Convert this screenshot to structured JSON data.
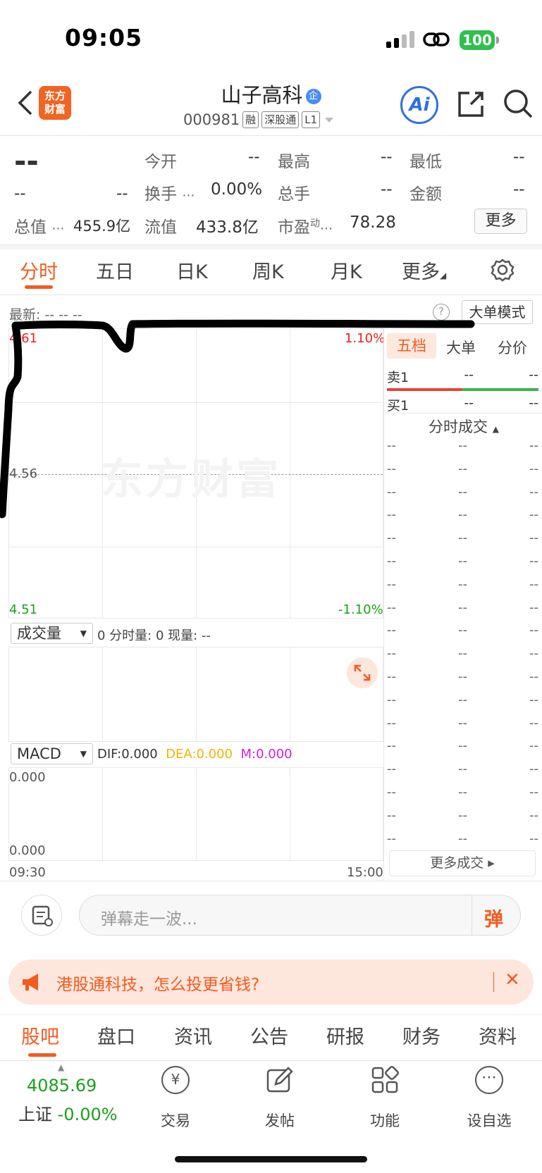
{
  "status_bar": {
    "time": "09:05",
    "battery": "100"
  },
  "header": {
    "title": "山子高科",
    "title_badge": "企",
    "code": "000981",
    "tags": [
      "融",
      "深股通",
      "L1"
    ],
    "logo_line1": "东方",
    "logo_line2": "财富",
    "ai_label": "Ai"
  },
  "quote": {
    "price": "--",
    "change": "--",
    "change_pct": "--",
    "open_label": "今开",
    "open": "--",
    "high_label": "最高",
    "high": "--",
    "low_label": "最低",
    "low": "--",
    "turnover_label": "换手",
    "turnover": "0.00%",
    "volume_label": "总手",
    "volume": "--",
    "amount_label": "金额",
    "amount": "--",
    "mcap_label": "总值",
    "mcap": "455.9亿",
    "float_label": "流值",
    "float": "433.8亿",
    "pe_label": "市盈",
    "pe_sup": "动",
    "pe": "78.28",
    "more_button": "更多"
  },
  "chart_tabs": [
    "分时",
    "五日",
    "日K",
    "周K",
    "月K",
    "更多"
  ],
  "chart_info": {
    "latest_label": "最新:",
    "latest_values": "--  --  --",
    "mode_button": "大单模式"
  },
  "intraday_chart": {
    "y_top": "4.61",
    "y_mid": "4.56",
    "y_bottom": "4.51",
    "pct_top": "1.10%",
    "pct_bottom": "-1.10%",
    "watermark": "东方财富",
    "time_start": "09:30",
    "time_end": "15:00"
  },
  "volume_panel": {
    "selector": "成交量",
    "info": "0 分时量: 0 现量: --"
  },
  "macd_panel": {
    "selector": "MACD",
    "dif": "DIF:0.000",
    "dea": "DEA:0.000",
    "m": "M:0.000",
    "y_top": "0.000",
    "y_bottom": "0.000"
  },
  "side_panel": {
    "tabs": [
      "五档",
      "大单",
      "分价"
    ],
    "sell1_label": "卖1",
    "sell1_price": "--",
    "sell1_vol": "--",
    "buy1_label": "买1",
    "buy1_price": "--",
    "buy1_vol": "--",
    "trades_title": "分时成交",
    "trade_placeholder": "--",
    "more_trades": "更多成交"
  },
  "comment": {
    "placeholder": "弹幕走一波...",
    "send_glyph": "弹"
  },
  "banner": {
    "text": "港股通科技，怎么投更省钱?"
  },
  "bottom_tabs": [
    "股吧",
    "盘口",
    "资讯",
    "公告",
    "研报",
    "财务",
    "资料"
  ],
  "bottom_nav": {
    "index_value": "4085.69",
    "index_name": "上证",
    "index_change": "-0.00%",
    "items": [
      "交易",
      "发帖",
      "功能",
      "设自选"
    ]
  },
  "colors": {
    "accent": "#f35b1f",
    "up": "#e8211d",
    "down": "#1aa11a",
    "blue": "#2f6fe4"
  }
}
